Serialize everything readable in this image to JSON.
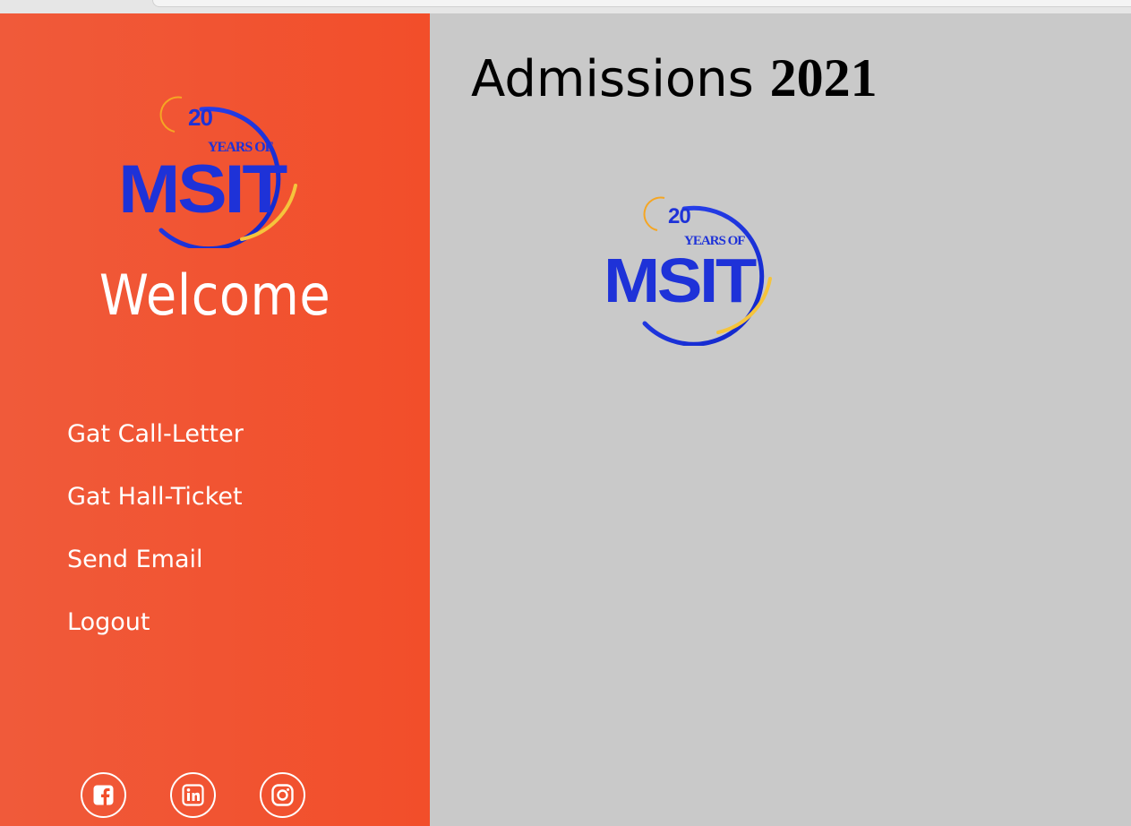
{
  "sidebar": {
    "logo": {
      "number": "20",
      "subtitle": "YEARS OF",
      "name": "MSIT",
      "icon": "msit-20-years-logo"
    },
    "welcome": "Welcome",
    "nav": [
      {
        "label": "Gat Call-Letter"
      },
      {
        "label": "Gat Hall-Ticket"
      },
      {
        "label": "Send Email"
      },
      {
        "label": "Logout"
      }
    ],
    "social": [
      {
        "icon": "facebook-icon"
      },
      {
        "icon": "linkedin-icon"
      },
      {
        "icon": "instagram-icon"
      }
    ]
  },
  "main": {
    "title_word": "Admissions",
    "title_year": "2021",
    "logo": {
      "number": "20",
      "subtitle": "YEARS OF",
      "name": "MSIT",
      "icon": "msit-20-years-logo"
    }
  },
  "colors": {
    "sidebar_bg": "#f24e2a",
    "main_bg": "#c9c9c9",
    "logo_blue": "#1e32d8",
    "logo_yellow": "#f5c43c",
    "text_light": "#ffffff"
  }
}
